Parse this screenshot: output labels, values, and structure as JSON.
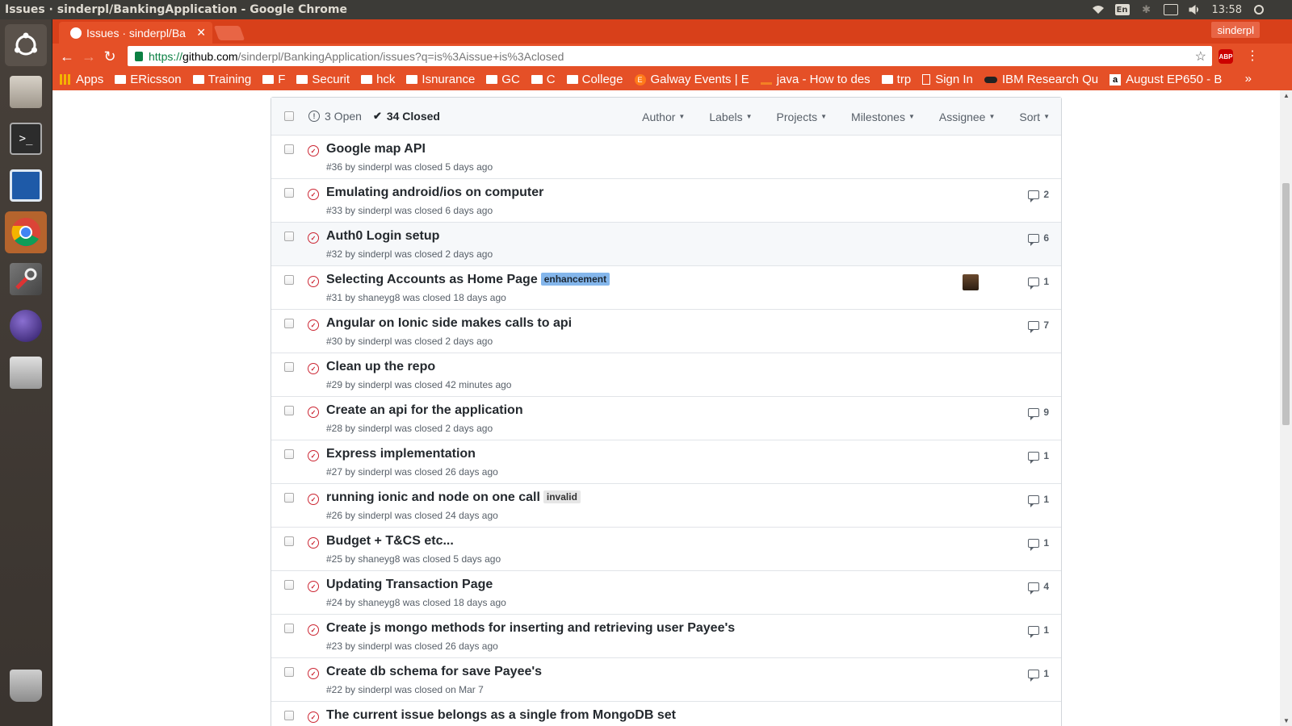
{
  "os": {
    "window_title": "Issues · sinderpl/BankingApplication - Google Chrome",
    "keyboard_layout": "En",
    "clock": "13:58"
  },
  "browser": {
    "tab_title": "Issues · sinderpl/Ba",
    "profile_name": "sinderpl",
    "url_scheme": "https://",
    "url_domain": "github.com",
    "url_path": "/sinderpl/BankingApplication/issues?q=is%3Aissue+is%3Aclosed",
    "abp_label": "ABP",
    "bookmarks": [
      {
        "label": "Apps",
        "icon": "apps-icon"
      },
      {
        "label": "ERicsson",
        "icon": "folder-icon"
      },
      {
        "label": "Training",
        "icon": "folder-icon"
      },
      {
        "label": "F",
        "icon": "folder-icon"
      },
      {
        "label": "Securit",
        "icon": "folder-icon"
      },
      {
        "label": "hck",
        "icon": "folder-icon"
      },
      {
        "label": "Isnurance",
        "icon": "folder-icon"
      },
      {
        "label": "GC",
        "icon": "folder-icon"
      },
      {
        "label": "C",
        "icon": "folder-icon"
      },
      {
        "label": "College",
        "icon": "folder-icon"
      },
      {
        "label": "Galway Events | E",
        "icon": "eventbrite-icon"
      },
      {
        "label": "java - How to des",
        "icon": "stackoverflow-icon"
      },
      {
        "label": "trp",
        "icon": "folder-icon"
      },
      {
        "label": "Sign In",
        "icon": "page-icon"
      },
      {
        "label": "IBM Research Qu",
        "icon": "ibm-icon"
      },
      {
        "label": "August EP650 - B",
        "icon": "amazon-icon"
      }
    ],
    "bookmarks_overflow": "»"
  },
  "issues": {
    "open_count": "3 Open",
    "closed_count": "34 Closed",
    "filters": [
      "Author",
      "Labels",
      "Projects",
      "Milestones",
      "Assignee",
      "Sort"
    ],
    "rows": [
      {
        "title": "Google map API",
        "label": "",
        "meta": "#36 by sinderpl was closed 5 days ago",
        "comments": ""
      },
      {
        "title": "Emulating android/ios on computer",
        "label": "",
        "meta": "#33 by sinderpl was closed 6 days ago",
        "comments": "2"
      },
      {
        "title": "Auth0 Login setup",
        "label": "",
        "meta": "#32 by sinderpl was closed 2 days ago",
        "comments": "6"
      },
      {
        "title": "Selecting Accounts as Home Page",
        "label": "enhancement",
        "meta": "#31 by shaneyg8 was closed 18 days ago",
        "comments": "1"
      },
      {
        "title": "Angular on Ionic side makes calls to api",
        "label": "",
        "meta": "#30 by sinderpl was closed 2 days ago",
        "comments": "7"
      },
      {
        "title": "Clean up the repo",
        "label": "",
        "meta": "#29 by sinderpl was closed 42 minutes ago",
        "comments": ""
      },
      {
        "title": "Create an api for the application",
        "label": "",
        "meta": "#28 by sinderpl was closed 2 days ago",
        "comments": "9"
      },
      {
        "title": "Express implementation",
        "label": "",
        "meta": "#27 by sinderpl was closed 26 days ago",
        "comments": "1"
      },
      {
        "title": "running ionic and node on one call",
        "label": "invalid",
        "meta": "#26 by sinderpl was closed 24 days ago",
        "comments": "1"
      },
      {
        "title": "Budget + T&CS etc...",
        "label": "",
        "meta": "#25 by shaneyg8 was closed 5 days ago",
        "comments": "1"
      },
      {
        "title": "Updating Transaction Page",
        "label": "",
        "meta": "#24 by shaneyg8 was closed 18 days ago",
        "comments": "4"
      },
      {
        "title": "Create js mongo methods for inserting and retrieving user Payee's",
        "label": "",
        "meta": "#23 by sinderpl was closed 26 days ago",
        "comments": "1"
      },
      {
        "title": "Create db schema for save Payee's",
        "label": "",
        "meta": "#22 by sinderpl was closed on Mar 7",
        "comments": "1"
      },
      {
        "title": "The current issue belongs as a single from MongoDB set",
        "label": "",
        "meta": "",
        "comments": ""
      }
    ]
  },
  "colors": {
    "chrome_accent": "#e55027",
    "closed_icon": "#cb2431",
    "enhancement_label": "#84b6eb",
    "invalid_label": "#e6e6e6"
  }
}
